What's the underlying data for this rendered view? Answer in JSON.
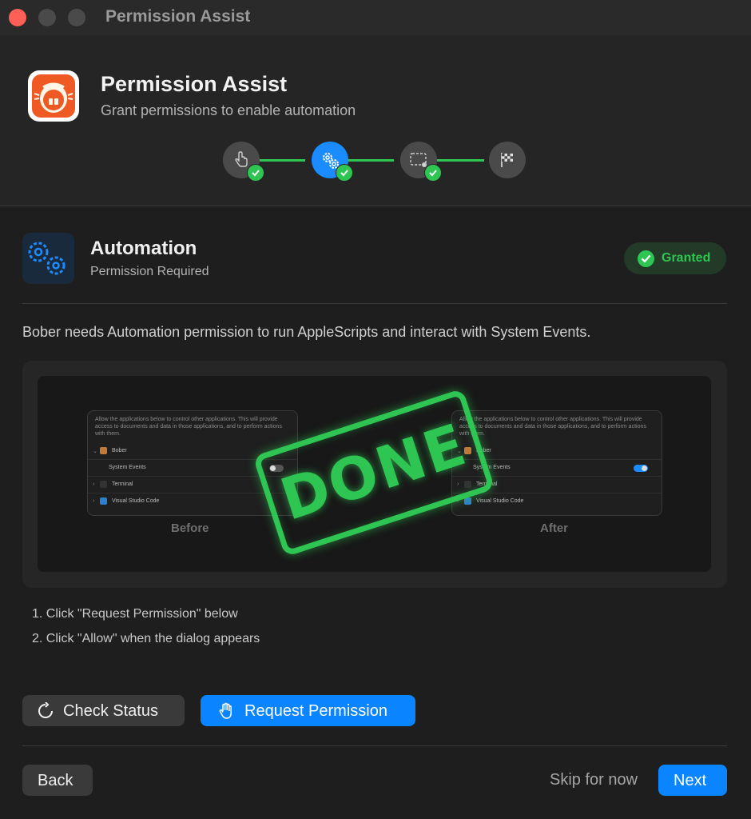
{
  "window": {
    "title": "Permission Assist"
  },
  "header": {
    "title": "Permission Assist",
    "subtitle": "Grant permissions to enable automation"
  },
  "wizard_steps": [
    {
      "icon": "hand-pointer-icon",
      "completed": true,
      "active": false
    },
    {
      "icon": "gears-icon",
      "completed": true,
      "active": true
    },
    {
      "icon": "screen-record-icon",
      "completed": true,
      "active": false
    },
    {
      "icon": "checkered-flag-icon",
      "completed": false,
      "active": false
    }
  ],
  "permission": {
    "title": "Automation",
    "subtitle": "Permission Required",
    "status": "Granted",
    "description": "Bober needs Automation permission to run AppleScripts and interact with System Events."
  },
  "preview": {
    "intro_text": "Allow the applications below to control other applications. This will provide access to documents and data in those applications, and to perform actions with them.",
    "rows": {
      "app": "Bober",
      "target": "System Events",
      "terminal": "Terminal",
      "vscode": "Visual Studio Code"
    },
    "before_label": "Before",
    "after_label": "After",
    "before_toggle_on": false,
    "after_toggle_on": true,
    "stamp_text": "DONE"
  },
  "instructions": [
    "1.  Click \"Request Permission\" below",
    "2.  Click \"Allow\" when the dialog appears"
  ],
  "actions": {
    "check_status": "Check Status",
    "request_permission": "Request Permission"
  },
  "footer": {
    "back": "Back",
    "skip": "Skip for now",
    "next": "Next"
  },
  "colors": {
    "accent": "#0a84ff",
    "success": "#2ec552",
    "brand": "#ef5a24"
  }
}
